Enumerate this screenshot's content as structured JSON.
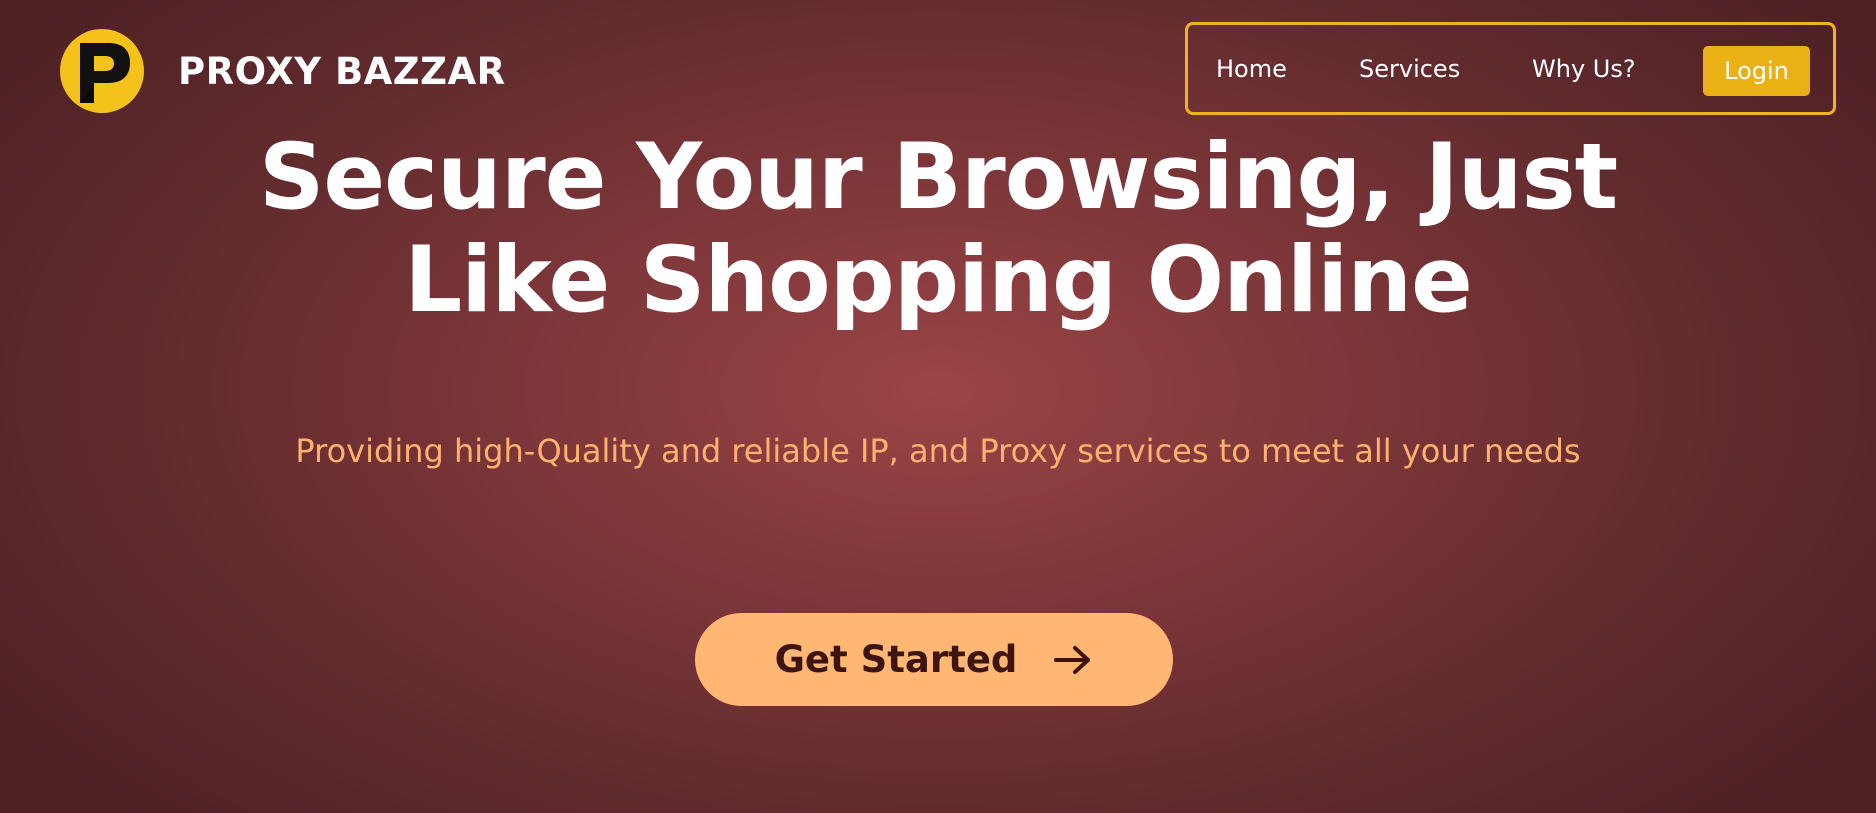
{
  "header": {
    "brand_name": "PROXY BAZZAR",
    "logo_icon": "letter-p-logo-icon"
  },
  "nav": {
    "items": [
      {
        "label": "Home"
      },
      {
        "label": "Services"
      },
      {
        "label": "Why Us?"
      }
    ],
    "login_label": "Login"
  },
  "hero": {
    "title_line1": "Secure Your Browsing, Just",
    "title_line2": "Like Shopping Online",
    "subtitle": "Providing high-Quality and reliable IP, and Proxy services to meet all your needs",
    "cta_label": "Get Started",
    "cta_icon": "arrow-right-icon"
  },
  "colors": {
    "background": "#7a3538",
    "accent_yellow": "#f0b41b",
    "subtitle_orange": "#ffb26f",
    "cta_background": "#ffb773",
    "cta_text": "#3d1410"
  }
}
